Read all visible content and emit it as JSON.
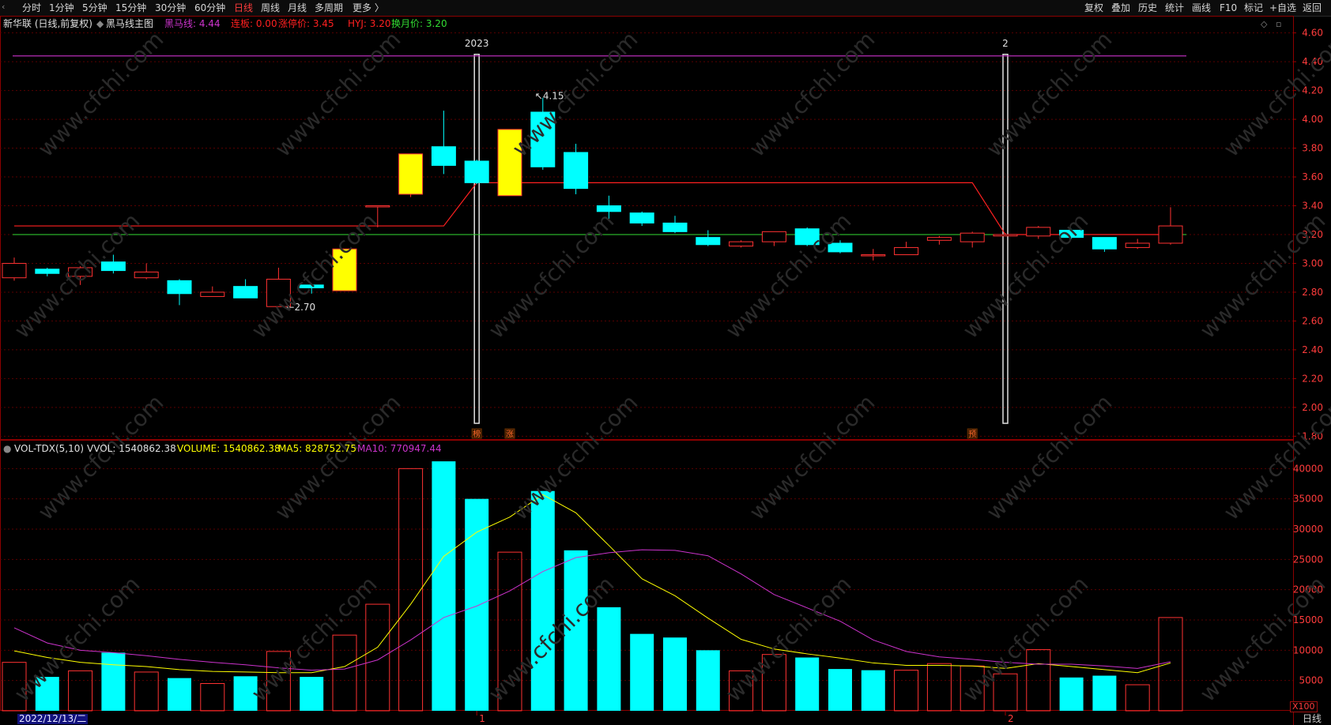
{
  "toolbar": {
    "left_items": [
      "分时",
      "1分钟",
      "5分钟",
      "15分钟",
      "30分钟",
      "60分钟",
      "日线",
      "周线",
      "月线",
      "多周期",
      "更多 〉"
    ],
    "active_item": "日线",
    "right_items": [
      "复权",
      "叠加",
      "历史",
      "统计",
      "画线",
      "F10",
      "标记",
      "+自选",
      "返回"
    ]
  },
  "info": {
    "stock": "新华联 (日线,前复权)",
    "indicator_name": "黑马线主图",
    "hmx_label": "黑马线: 4.44",
    "lianban_label": "连板: 0.00",
    "limitup_label": "涨停价: 3.45",
    "hyj_label": "HYJ: 3.20",
    "turnover_label": "换月价: 3.20"
  },
  "vol_info": {
    "name": "VOL-TDX(5,10)",
    "vvol": "VVOL: 1540862.38",
    "volume": "VOLUME: 1540862.38",
    "ma5": "MA5: 828752.75",
    "ma10": "MA10: 770947.44"
  },
  "colors": {
    "up": "#ff3232",
    "down": "#00ffff",
    "special": "#ffff00",
    "hmx": "#cc33cc",
    "hyj": "#ff2020",
    "turnover": "#33dd33",
    "ma5": "#ffff00",
    "ma10": "#cc33cc"
  },
  "chart_data": [
    {
      "type": "candlestick",
      "y_axis_ticks": [
        "4.60",
        "4.40",
        "4.20",
        "4.00",
        "3.80",
        "3.60",
        "3.40",
        "3.20",
        "3.00",
        "2.80",
        "2.60",
        "2.40",
        "2.20",
        "2.00",
        "1.80"
      ],
      "ylim": [
        1.78,
        4.62
      ],
      "candles": [
        {
          "o": 2.9,
          "c": 3.0,
          "h": 3.04,
          "l": 2.88
        },
        {
          "o": 2.96,
          "c": 2.93,
          "h": 2.97,
          "l": 2.91
        },
        {
          "o": 2.91,
          "c": 2.97,
          "h": 2.98,
          "l": 2.85
        },
        {
          "o": 3.01,
          "c": 2.95,
          "h": 3.06,
          "l": 2.93
        },
        {
          "o": 2.9,
          "c": 2.94,
          "h": 3.0,
          "l": 2.89
        },
        {
          "o": 2.88,
          "c": 2.79,
          "h": 2.89,
          "l": 2.71
        },
        {
          "o": 2.77,
          "c": 2.8,
          "h": 2.84,
          "l": 2.77
        },
        {
          "o": 2.84,
          "c": 2.76,
          "h": 2.89,
          "l": 2.76
        },
        {
          "o": 2.7,
          "c": 2.89,
          "h": 2.97,
          "l": 2.7
        },
        {
          "o": 2.85,
          "c": 2.83,
          "h": 2.86,
          "l": 2.79
        },
        {
          "o": 2.81,
          "c": 3.1,
          "h": 3.1,
          "l": 2.81,
          "special": true
        },
        {
          "o": 3.4,
          "c": 3.4,
          "h": 3.4,
          "l": 3.25
        },
        {
          "o": 3.48,
          "c": 3.76,
          "h": 3.76,
          "l": 3.46,
          "special": true
        },
        {
          "o": 3.81,
          "c": 3.68,
          "h": 4.06,
          "l": 3.62
        },
        {
          "o": 3.71,
          "c": 3.56,
          "h": 3.72,
          "l": 3.55
        },
        {
          "o": 3.47,
          "c": 3.93,
          "h": 3.93,
          "l": 3.47,
          "special": true
        },
        {
          "o": 4.05,
          "c": 3.67,
          "h": 4.15,
          "l": 3.65
        },
        {
          "o": 3.77,
          "c": 3.52,
          "h": 3.83,
          "l": 3.48
        },
        {
          "o": 3.4,
          "c": 3.36,
          "h": 3.47,
          "l": 3.31
        },
        {
          "o": 3.35,
          "c": 3.28,
          "h": 3.36,
          "l": 3.26
        },
        {
          "o": 3.28,
          "c": 3.22,
          "h": 3.33,
          "l": 3.21
        },
        {
          "o": 3.18,
          "c": 3.13,
          "h": 3.23,
          "l": 3.12
        },
        {
          "o": 3.12,
          "c": 3.15,
          "h": 3.16,
          "l": 3.11
        },
        {
          "o": 3.15,
          "c": 3.22,
          "h": 3.22,
          "l": 3.12
        },
        {
          "o": 3.24,
          "c": 3.13,
          "h": 3.25,
          "l": 3.12
        },
        {
          "o": 3.14,
          "c": 3.08,
          "h": 3.16,
          "l": 3.07
        },
        {
          "o": 3.06,
          "c": 3.06,
          "h": 3.1,
          "l": 3.02
        },
        {
          "o": 3.06,
          "c": 3.11,
          "h": 3.15,
          "l": 3.06
        },
        {
          "o": 3.16,
          "c": 3.18,
          "h": 3.19,
          "l": 3.13
        },
        {
          "o": 3.15,
          "c": 3.21,
          "h": 3.22,
          "l": 3.11
        },
        {
          "o": 3.19,
          "c": 3.2,
          "h": 3.21,
          "l": 3.19
        },
        {
          "o": 3.19,
          "c": 3.25,
          "h": 3.26,
          "l": 3.17
        },
        {
          "o": 3.23,
          "c": 3.18,
          "h": 3.24,
          "l": 3.17
        },
        {
          "o": 3.18,
          "c": 3.1,
          "h": 3.18,
          "l": 3.08
        },
        {
          "o": 3.11,
          "c": 3.14,
          "h": 3.17,
          "l": 3.1
        },
        {
          "o": 3.14,
          "c": 3.26,
          "h": 3.39,
          "l": 3.13
        }
      ],
      "hmx_line": 4.44,
      "turnover_line": 3.2,
      "hyj_line": [
        3.26,
        3.26,
        3.26,
        3.26,
        3.26,
        3.26,
        3.26,
        3.26,
        3.26,
        3.26,
        3.26,
        3.26,
        3.26,
        3.26,
        3.56,
        3.56,
        3.56,
        3.56,
        3.56,
        3.56,
        3.56,
        3.56,
        3.56,
        3.56,
        3.56,
        3.56,
        3.56,
        3.56,
        3.56,
        3.56,
        3.2,
        3.2,
        3.2,
        3.2,
        3.2,
        3.2
      ],
      "vertical_markers": [
        {
          "index": 14,
          "label": "2023"
        },
        {
          "index": 30,
          "label": "2"
        }
      ],
      "bottom_tags": [
        {
          "index": 14,
          "label": "榜"
        },
        {
          "index": 15,
          "label": "涨"
        },
        {
          "index": 29,
          "label": "预"
        }
      ],
      "annotations": [
        {
          "index": 8,
          "label": "2.70",
          "anchor": "low"
        },
        {
          "index": 16,
          "label": "4.15",
          "anchor": "high"
        }
      ]
    },
    {
      "type": "bar",
      "title": "VOL-TDX(5,10)",
      "y_axis_ticks": [
        "40000",
        "35000",
        "30000",
        "25000",
        "20000",
        "15000",
        "10000",
        "5000"
      ],
      "unit_label": "X100",
      "ylim": [
        0,
        42000
      ],
      "volume": [
        8000,
        5600,
        6600,
        9600,
        6400,
        5400,
        4500,
        5700,
        9800,
        5600,
        12500,
        17600,
        40000,
        41200,
        35000,
        26200,
        36300,
        26500,
        17100,
        12700,
        12100,
        10000,
        6600,
        9300,
        8800,
        6900,
        6700,
        6700,
        7800,
        7400,
        6100,
        10100,
        5500,
        5800,
        4300,
        15400
      ],
      "ma5": [
        9900,
        8800,
        8000,
        7600,
        7300,
        6800,
        6500,
        6400,
        6300,
        6300,
        7300,
        10500,
        17600,
        25500,
        29500,
        32000,
        35700,
        32700,
        27300,
        21800,
        19000,
        15300,
        11800,
        10200,
        9400,
        8700,
        7900,
        7500,
        7500,
        7400,
        7000,
        7800,
        7300,
        6800,
        6300,
        7900
      ],
      "ma10": [
        13700,
        11200,
        10000,
        9600,
        9100,
        8500,
        8000,
        7600,
        7100,
        6700,
        6900,
        8400,
        11700,
        15400,
        17300,
        19800,
        23000,
        25300,
        26100,
        26600,
        26500,
        25600,
        22600,
        19200,
        17000,
        14800,
        11700,
        9800,
        8900,
        8500,
        8000,
        7700,
        7700,
        7400,
        7000,
        8100
      ],
      "x_tick_labels": [
        {
          "index": 0,
          "label": "2022/12/13/二"
        },
        {
          "index": 14,
          "label": "1"
        },
        {
          "index": 30,
          "label": "2"
        }
      ]
    }
  ],
  "status": {
    "date_label": "2022/12/13/二",
    "timeframe": "日线",
    "unit": "X100"
  }
}
